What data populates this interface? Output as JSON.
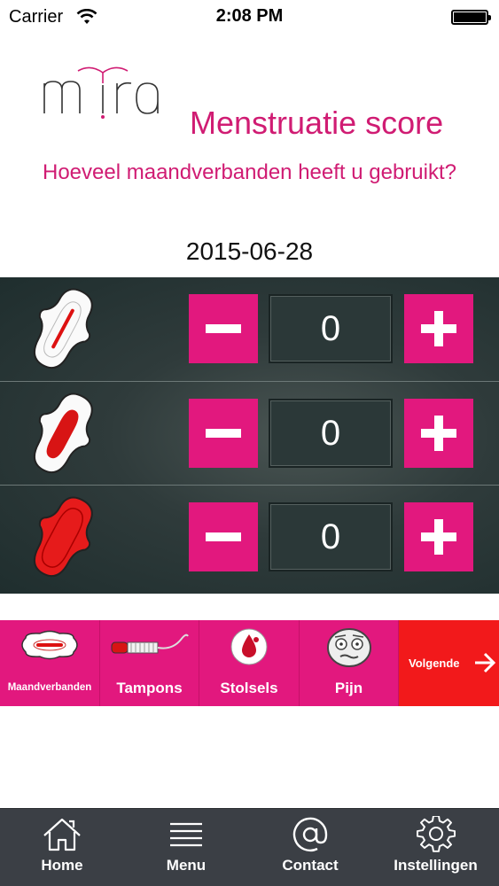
{
  "status_bar": {
    "carrier": "Carrier",
    "time": "2:08 PM"
  },
  "header": {
    "logo_text": "mira",
    "title": "Menstruatie score",
    "question": "Hoeveel maandverbanden heeft u gebruikt?",
    "date": "2015-06-28"
  },
  "counters": [
    {
      "level": "light",
      "value": "0",
      "icon": "pad-light-icon"
    },
    {
      "level": "medium",
      "value": "0",
      "icon": "pad-medium-icon"
    },
    {
      "level": "heavy",
      "value": "0",
      "icon": "pad-heavy-icon"
    }
  ],
  "categories": [
    {
      "label": "Maandverbanden",
      "icon": "pad-icon"
    },
    {
      "label": "Tampons",
      "icon": "tampon-icon"
    },
    {
      "label": "Stolsels",
      "icon": "blood-drop-icon"
    },
    {
      "label": "Pijn",
      "icon": "pain-face-icon"
    }
  ],
  "next": {
    "label": "Volgende",
    "icon": "arrow-right-icon"
  },
  "tab_bar": [
    {
      "label": "Home",
      "icon": "home-icon"
    },
    {
      "label": "Menu",
      "icon": "menu-icon"
    },
    {
      "label": "Contact",
      "icon": "at-icon"
    },
    {
      "label": "Instellingen",
      "icon": "gear-icon"
    }
  ],
  "colors": {
    "accent": "#e2187e",
    "title": "#d01c73",
    "next": "#f2191b",
    "panel": "#2f3b3b",
    "tab_bar": "#3b3f45"
  }
}
